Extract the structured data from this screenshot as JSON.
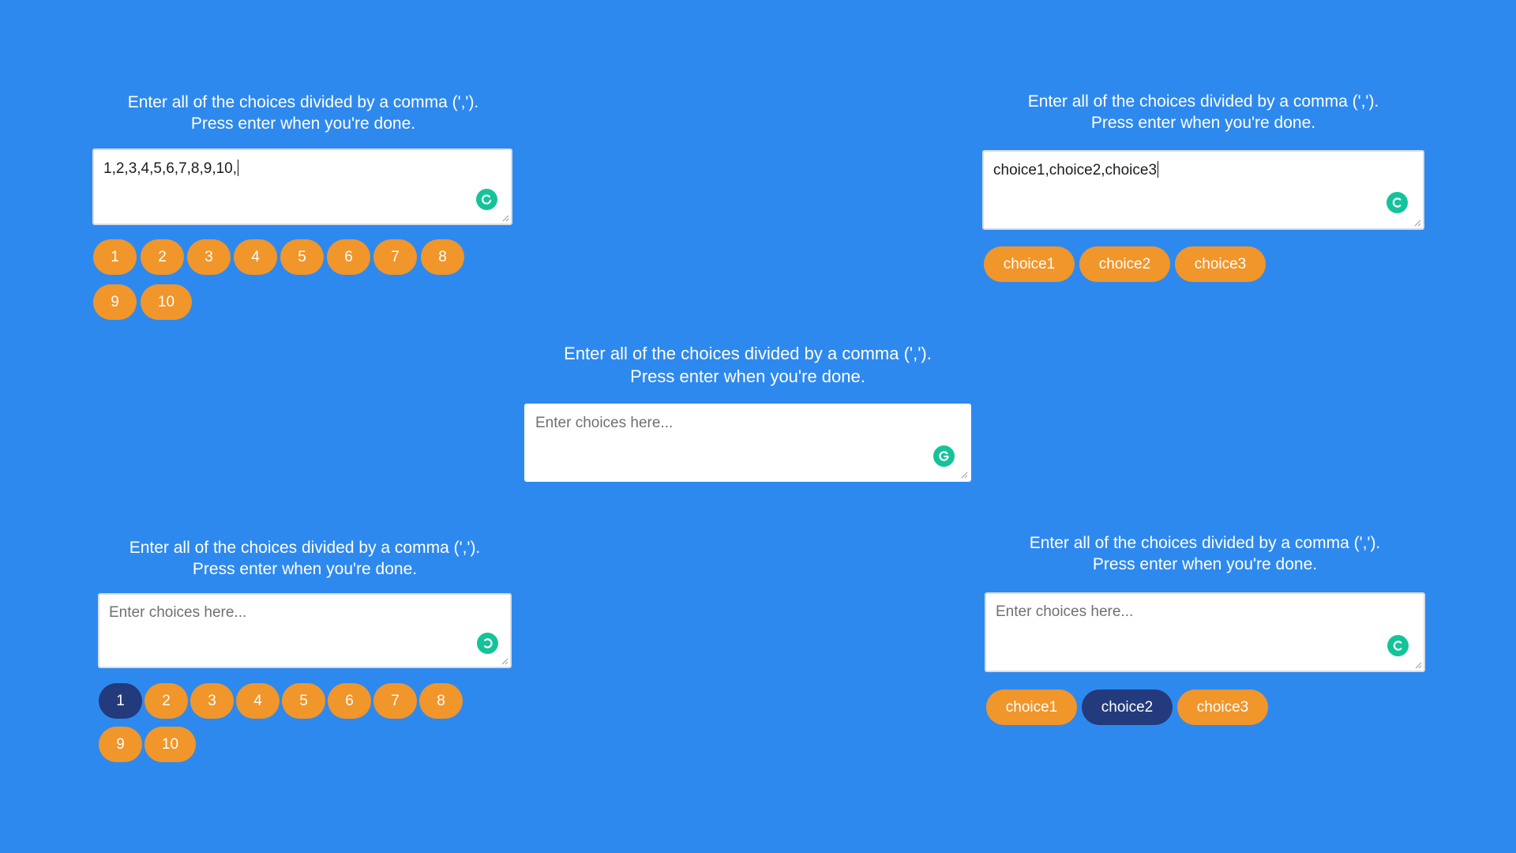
{
  "panel_top_left": {
    "line1": "Enter all of the choices divided by a comma (',').",
    "line2": "Press enter when you're done.",
    "input_value": "1,2,3,4,5,6,7,8,9,10,",
    "placeholder": "Enter choices here...",
    "icon": "grammarly-icon",
    "chips": [
      {
        "label": "1",
        "selected": false
      },
      {
        "label": "2",
        "selected": false
      },
      {
        "label": "3",
        "selected": false
      },
      {
        "label": "4",
        "selected": false
      },
      {
        "label": "5",
        "selected": false
      },
      {
        "label": "6",
        "selected": false
      },
      {
        "label": "7",
        "selected": false
      },
      {
        "label": "8",
        "selected": false
      },
      {
        "label": "9",
        "selected": false
      },
      {
        "label": "10",
        "selected": false
      }
    ]
  },
  "panel_top_right": {
    "line1": "Enter all of the choices divided by a comma (',').",
    "line2": "Press enter when you're done.",
    "input_value": "choice1,choice2,choice3",
    "placeholder": "Enter choices here...",
    "icon": "grammarly-icon",
    "chips": [
      {
        "label": "choice1",
        "selected": false
      },
      {
        "label": "choice2",
        "selected": false
      },
      {
        "label": "choice3",
        "selected": false
      }
    ]
  },
  "panel_center": {
    "line1": "Enter all of the choices divided by a comma (',').",
    "line2": "Press enter when you're done.",
    "input_value": "",
    "placeholder": "Enter choices here...",
    "icon": "grammarly-icon"
  },
  "panel_bottom_left": {
    "line1": "Enter all of the choices divided by a comma (',').",
    "line2": "Press enter when you're done.",
    "input_value": "",
    "placeholder": "Enter choices here...",
    "icon": "grammarly-icon",
    "chips": [
      {
        "label": "1",
        "selected": true
      },
      {
        "label": "2",
        "selected": false
      },
      {
        "label": "3",
        "selected": false
      },
      {
        "label": "4",
        "selected": false
      },
      {
        "label": "5",
        "selected": false
      },
      {
        "label": "6",
        "selected": false
      },
      {
        "label": "7",
        "selected": false
      },
      {
        "label": "8",
        "selected": false
      },
      {
        "label": "9",
        "selected": false
      },
      {
        "label": "10",
        "selected": false
      }
    ]
  },
  "panel_bottom_right": {
    "line1": "Enter all of the choices divided by a comma (',').",
    "line2": "Press enter when you're done.",
    "input_value": "",
    "placeholder": "Enter choices here...",
    "icon": "grammarly-icon",
    "chips": [
      {
        "label": "choice1",
        "selected": false
      },
      {
        "label": "choice2",
        "selected": true
      },
      {
        "label": "choice3",
        "selected": false
      }
    ]
  },
  "colors": {
    "background": "#2e89ee",
    "chip": "#f0962a",
    "chip_selected": "#233b7c",
    "grammarly": "#15c39a"
  }
}
